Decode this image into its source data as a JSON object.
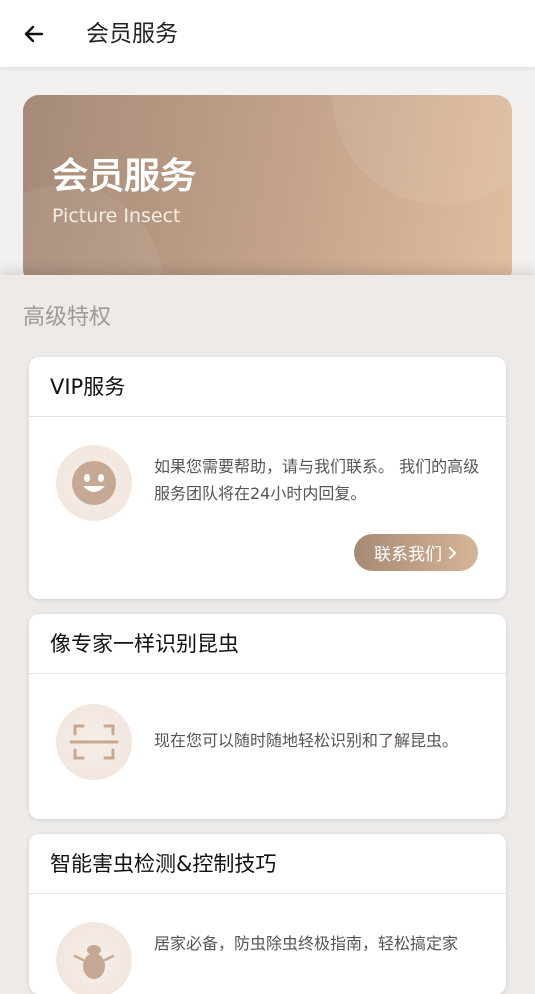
{
  "topbar": {
    "title": "会员服务"
  },
  "hero": {
    "title": "会员服务",
    "subtitle": "Picture Insect"
  },
  "section": {
    "title": "高级特权"
  },
  "cards": [
    {
      "title": "VIP服务",
      "icon": "smiley-face-icon",
      "text": "如果您需要帮助，请与我们联系。 我们的高级服务团队将在24小时内回复。",
      "button": "联系我们"
    },
    {
      "title": "像专家一样识别昆虫",
      "icon": "scan-frame-icon",
      "text": "现在您可以随时随地轻松识别和了解昆虫。"
    },
    {
      "title": "智能害虫检测&控制技巧",
      "icon": "bug-icon",
      "text": "居家必备，防虫除虫终极指南，轻松搞定家"
    }
  ],
  "colors": {
    "accent_start": "#a68a74",
    "accent_end": "#d6b596",
    "background": "#eeeae7"
  }
}
